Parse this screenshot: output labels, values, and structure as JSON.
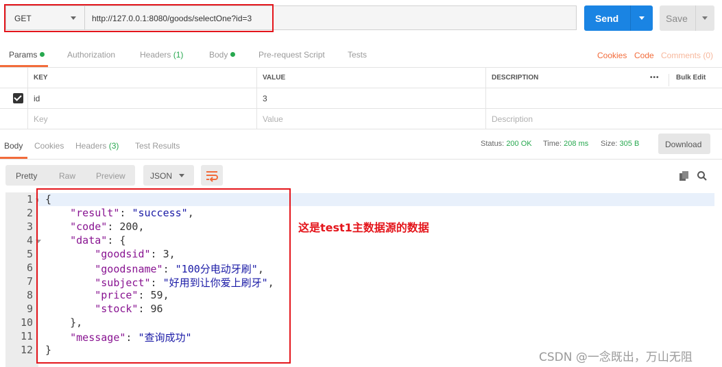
{
  "request": {
    "method": "GET",
    "url": "http://127.0.0.1:8080/goods/selectOne?id=3",
    "send_label": "Send",
    "save_label": "Save"
  },
  "request_tabs": {
    "params": "Params",
    "authorization": "Authorization",
    "headers": "Headers",
    "headers_count": "(1)",
    "body": "Body",
    "prerequest": "Pre-request Script",
    "tests": "Tests",
    "cookies": "Cookies",
    "code": "Code",
    "comments": "Comments (0)"
  },
  "params_table": {
    "headers": {
      "key": "KEY",
      "value": "VALUE",
      "description": "DESCRIPTION",
      "bulk_edit": "Bulk Edit"
    },
    "rows": [
      {
        "key": "id",
        "value": "3",
        "checked": true
      }
    ],
    "placeholders": {
      "key": "Key",
      "value": "Value",
      "description": "Description"
    }
  },
  "response_tabs": {
    "body": "Body",
    "cookies": "Cookies",
    "headers": "Headers",
    "headers_count": "(3)",
    "test_results": "Test Results"
  },
  "response_status": {
    "status_label": "Status:",
    "status_value": "200 OK",
    "time_label": "Time:",
    "time_value": "208 ms",
    "size_label": "Size:",
    "size_value": "305 B",
    "download_label": "Download"
  },
  "view": {
    "pretty": "Pretty",
    "raw": "Raw",
    "preview": "Preview",
    "format": "JSON"
  },
  "code_lines": [
    "1",
    "2",
    "3",
    "4",
    "5",
    "6",
    "7",
    "8",
    "9",
    "10",
    "11",
    "12"
  ],
  "json": {
    "k_result": "\"result\"",
    "v_result": "\"success\"",
    "k_code": "\"code\"",
    "v_code": "200",
    "k_data": "\"data\"",
    "k_goodsid": "\"goodsid\"",
    "v_goodsid": "3",
    "k_goodsname": "\"goodsname\"",
    "v_goodsname": "\"100分电动牙刷\"",
    "k_subject": "\"subject\"",
    "v_subject": "\"好用到让你爱上刷牙\"",
    "k_price": "\"price\"",
    "v_price": "59",
    "k_stock": "\"stock\"",
    "v_stock": "96",
    "k_message": "\"message\"",
    "v_message": "\"查询成功\""
  },
  "annotation": "这是test1主数据源的数据",
  "watermark": "CSDN @一念既出，万山无阻",
  "colors": {
    "accent": "#f26b3a",
    "send": "#1a84e3",
    "success": "#27a84f",
    "highlight_box": "#e4151b"
  }
}
